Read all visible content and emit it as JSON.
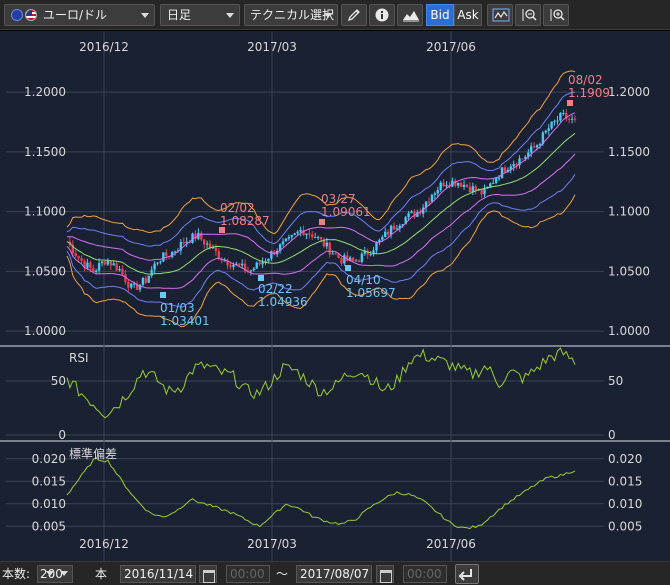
{
  "toolbar": {
    "symbol": "ユーロ/ドル",
    "period": "日足",
    "technical": "テクニカル選択",
    "bid_label": "Bid",
    "ask_label": "Ask"
  },
  "chart_data": [
    {
      "type": "candlestick",
      "title": "",
      "x_ticks": [
        "2016/12",
        "2017/03",
        "2017/06"
      ],
      "y_ticks": [
        "1.2000",
        "1.1500",
        "1.1000",
        "1.0500",
        "1.0000"
      ],
      "ylim": [
        0.985,
        1.211
      ],
      "grid": true,
      "date_range": [
        "2016/11/14",
        "2017/08/07"
      ],
      "overlays": [
        "Bollinger Bands (±1σ, ±2σ, ±3σ)",
        "moving average"
      ],
      "close_approx": [
        1.075,
        1.06,
        1.05,
        1.06,
        1.052,
        1.035,
        1.042,
        1.06,
        1.065,
        1.075,
        1.08,
        1.07,
        1.06,
        1.055,
        1.05,
        1.058,
        1.068,
        1.075,
        1.085,
        1.08,
        1.07,
        1.06,
        1.058,
        1.065,
        1.075,
        1.087,
        1.095,
        1.1,
        1.115,
        1.125,
        1.125,
        1.12,
        1.115,
        1.13,
        1.14,
        1.145,
        1.155,
        1.17,
        1.18,
        1.175
      ],
      "annotations": [
        {
          "label": "02/02",
          "value": "1.08287",
          "kind": "high"
        },
        {
          "label": "03/27",
          "value": "1.09061",
          "kind": "high"
        },
        {
          "label": "08/02",
          "value": "1.1909",
          "kind": "high"
        },
        {
          "label": "01/03",
          "value": "1.03401",
          "kind": "low"
        },
        {
          "label": "02/22",
          "value": "1.04936",
          "kind": "low"
        },
        {
          "label": "04/10",
          "value": "1.05697",
          "kind": "low"
        }
      ],
      "colors": {
        "up": "#49c8f0",
        "down": "#e83e4e",
        "band_outer": "#f5a040",
        "band_2": "#6f7ff5",
        "band_1": "#d870f5",
        "ma": "#8ee070"
      }
    },
    {
      "type": "line",
      "title": "RSI",
      "y_ticks": [
        "50",
        "0"
      ],
      "ylim": [
        0,
        100
      ],
      "color": "#9acd32"
    },
    {
      "type": "line",
      "title": "標準偏差",
      "y_ticks": [
        "0.020",
        "0.015",
        "0.010",
        "0.005"
      ],
      "ylim": [
        0.0025,
        0.0225
      ],
      "color": "#9acd32"
    }
  ],
  "bottom": {
    "count_label": "本数:",
    "count_value": "200",
    "unit_label": "本",
    "start_date": "2016/11/14",
    "start_time": "00:00",
    "tilde": "～",
    "end_date": "2017/08/07",
    "end_time": "00:00"
  }
}
